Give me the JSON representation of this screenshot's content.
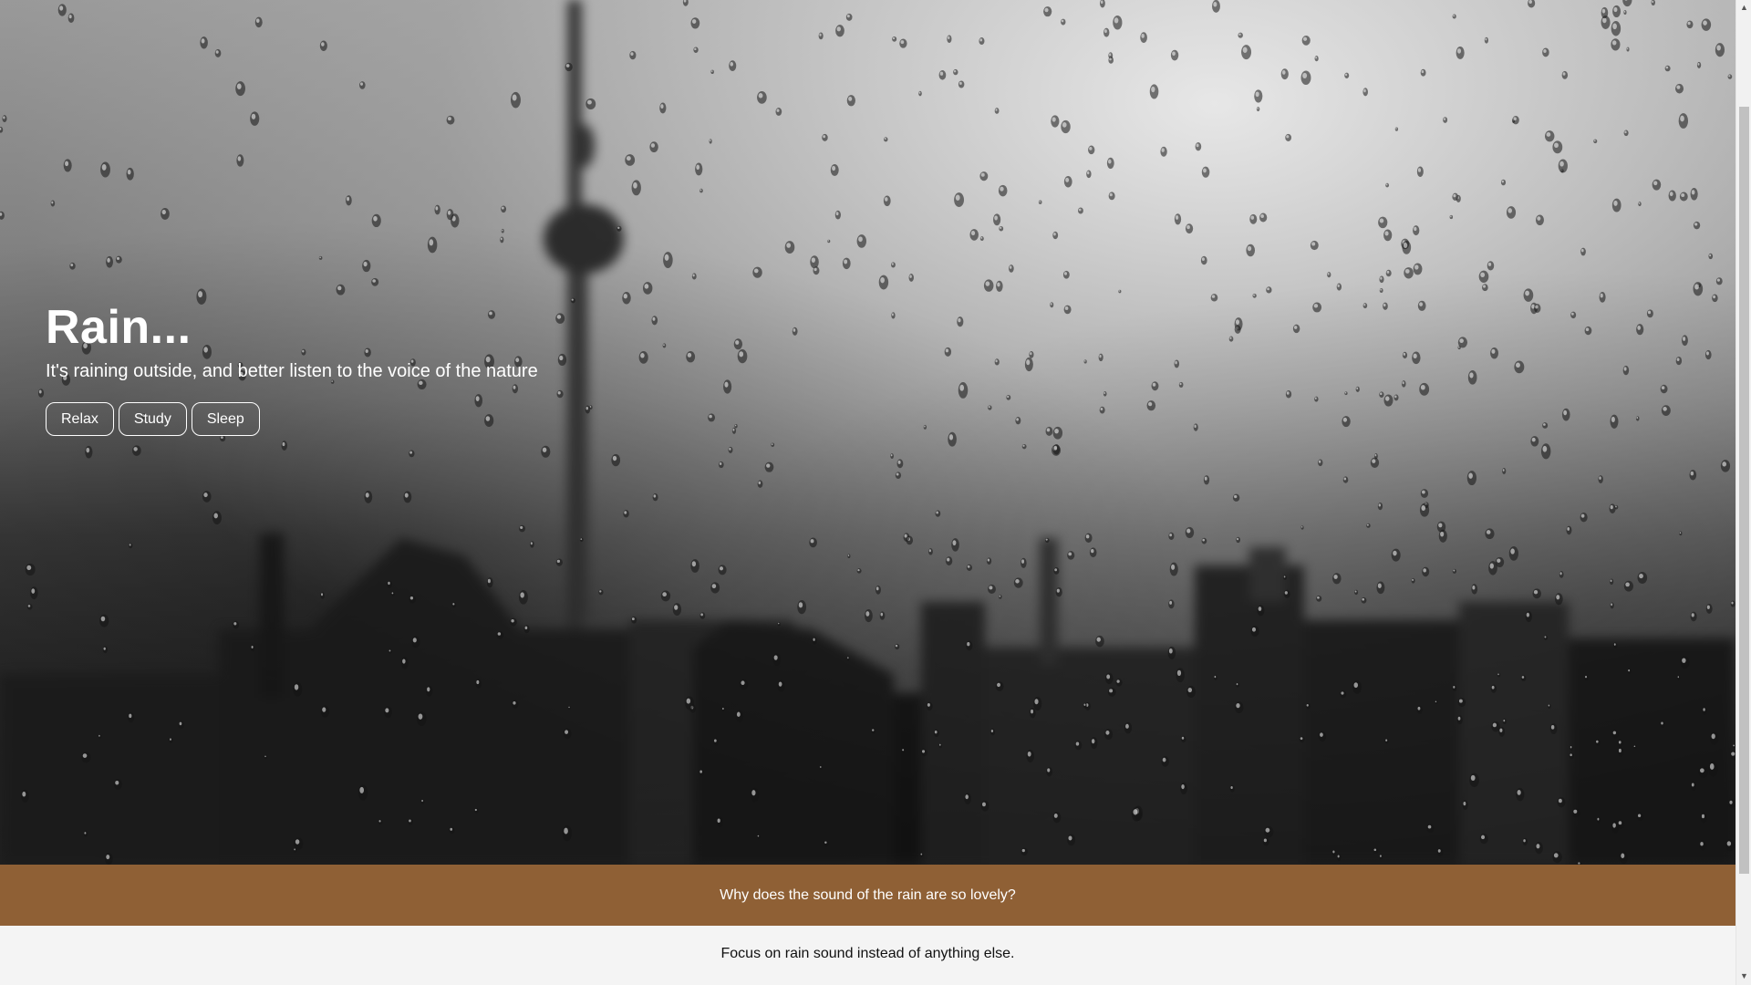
{
  "hero": {
    "title": "Rain...",
    "subtitle": "It's raining outside, and better listen to the voice of the nature",
    "buttons": [
      {
        "label": "Relax"
      },
      {
        "label": "Study"
      },
      {
        "label": "Sleep"
      }
    ]
  },
  "banner": {
    "text": "Why does the sound of the rain are so lovely?"
  },
  "content": {
    "text": "Focus on rain sound instead of anything else."
  },
  "colors": {
    "banner_bg": "#8f6035",
    "page_bg": "#f4f4f4",
    "hero_text": "#ffffff"
  }
}
